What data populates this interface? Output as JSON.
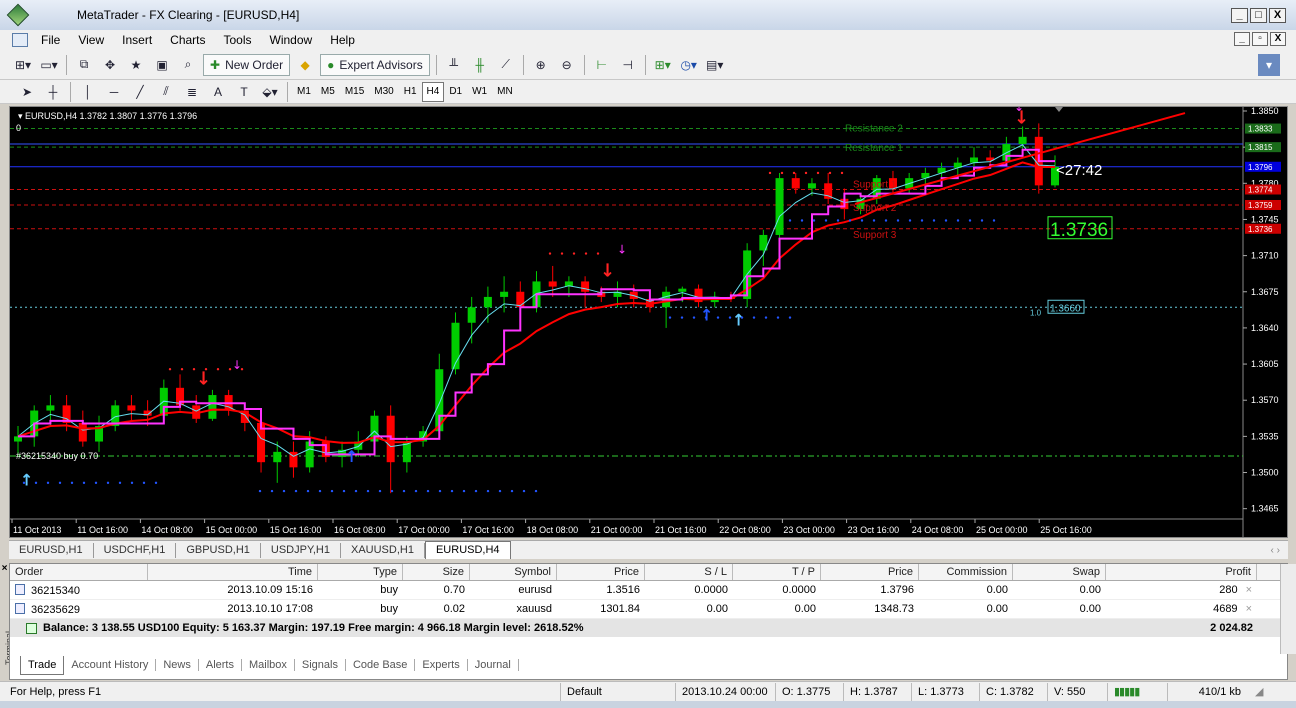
{
  "window": {
    "title": "MetaTrader - FX Clearing - [EURUSD,H4]",
    "buttons": [
      "_",
      "□",
      "X"
    ]
  },
  "menu": {
    "items": [
      "File",
      "View",
      "Insert",
      "Charts",
      "Tools",
      "Window",
      "Help"
    ],
    "mdi_buttons": [
      "_",
      "▫",
      "X"
    ]
  },
  "toolbar": {
    "new_order": "New Order",
    "expert_advisors": "Expert Advisors",
    "timeframes": [
      "M1",
      "M5",
      "M15",
      "M30",
      "H1",
      "H4",
      "D1",
      "W1",
      "MN"
    ],
    "active_timeframe": "H4",
    "text_tool": "A"
  },
  "chart": {
    "header": "EURUSD,H4  1.3782 1.3807 1.3776 1.3796",
    "corner_label": "0",
    "timer": "<27:42",
    "big_price": "1.3736",
    "small_label": "1.3660",
    "small_label_prefix": "1.0",
    "order_label": "#36215340 buy 0.70",
    "levels": {
      "resistance2": "Resistance 2",
      "resistance1": "Resistance 1",
      "support1": "Support 1",
      "support2": "Support 2",
      "support3": "Support 3"
    },
    "colors": {
      "bull": "#00cc00",
      "bear": "#ff0000",
      "ma_red": "#ff0000",
      "ma_green": "#33ff33",
      "magenta": "#ff33ff",
      "cyan": "#66ddee",
      "axis_text": "#ffffff"
    }
  },
  "chart_data": {
    "type": "candlestick",
    "title": "EURUSD,H4",
    "ylim": [
      1.3455,
      1.385
    ],
    "y_ticks": [
      "1.3850",
      "1.3815",
      "1.3780",
      "1.3745",
      "1.3710",
      "1.3675",
      "1.3640",
      "1.3605",
      "1.3570",
      "1.3535",
      "1.3500",
      "1.3465"
    ],
    "price_tags": [
      {
        "label": "1.3833",
        "color": "#1a6b1a"
      },
      {
        "label": "1.3815",
        "color": "#1a6b1a"
      },
      {
        "label": "1.3796",
        "color": "#0000dd"
      },
      {
        "label": "1.3774",
        "color": "#cc0000"
      },
      {
        "label": "1.3759",
        "color": "#cc0000"
      },
      {
        "label": "1.3736",
        "color": "#cc0000"
      }
    ],
    "x_labels": [
      "11 Oct 2013",
      "11 Oct 16:00",
      "14 Oct 08:00",
      "15 Oct 00:00",
      "15 Oct 16:00",
      "16 Oct 08:00",
      "17 Oct 00:00",
      "17 Oct 16:00",
      "18 Oct 08:00",
      "21 Oct 00:00",
      "21 Oct 16:00",
      "22 Oct 08:00",
      "23 Oct 00:00",
      "23 Oct 16:00",
      "24 Oct 08:00",
      "25 Oct 00:00",
      "25 Oct 16:00"
    ],
    "ohlc": [
      [
        1.353,
        1.3545,
        1.3515,
        1.3535
      ],
      [
        1.3535,
        1.3565,
        1.3525,
        1.356
      ],
      [
        1.356,
        1.3575,
        1.3545,
        1.3565
      ],
      [
        1.3565,
        1.3575,
        1.354,
        1.3548
      ],
      [
        1.3548,
        1.356,
        1.3525,
        1.353
      ],
      [
        1.353,
        1.3555,
        1.352,
        1.3545
      ],
      [
        1.3545,
        1.357,
        1.354,
        1.3565
      ],
      [
        1.3565,
        1.3575,
        1.355,
        1.356
      ],
      [
        1.356,
        1.357,
        1.3545,
        1.3555
      ],
      [
        1.3555,
        1.359,
        1.355,
        1.3582
      ],
      [
        1.3582,
        1.3595,
        1.356,
        1.3565
      ],
      [
        1.3565,
        1.3575,
        1.3548,
        1.3552
      ],
      [
        1.3552,
        1.358,
        1.355,
        1.3575
      ],
      [
        1.3575,
        1.358,
        1.3555,
        1.356
      ],
      [
        1.356,
        1.3565,
        1.354,
        1.3548
      ],
      [
        1.3548,
        1.356,
        1.35,
        1.351
      ],
      [
        1.351,
        1.353,
        1.349,
        1.352
      ],
      [
        1.352,
        1.353,
        1.3495,
        1.3505
      ],
      [
        1.3505,
        1.354,
        1.35,
        1.353
      ],
      [
        1.353,
        1.3535,
        1.351,
        1.3515
      ],
      [
        1.3515,
        1.353,
        1.3505,
        1.3522
      ],
      [
        1.3522,
        1.354,
        1.3515,
        1.353
      ],
      [
        1.353,
        1.356,
        1.3525,
        1.3555
      ],
      [
        1.3555,
        1.3565,
        1.348,
        1.351
      ],
      [
        1.351,
        1.3535,
        1.35,
        1.353
      ],
      [
        1.353,
        1.3545,
        1.3525,
        1.354
      ],
      [
        1.354,
        1.3615,
        1.3535,
        1.36
      ],
      [
        1.36,
        1.3655,
        1.3595,
        1.3645
      ],
      [
        1.3645,
        1.367,
        1.3625,
        1.366
      ],
      [
        1.366,
        1.368,
        1.3645,
        1.367
      ],
      [
        1.367,
        1.369,
        1.3655,
        1.3675
      ],
      [
        1.3675,
        1.3685,
        1.365,
        1.366
      ],
      [
        1.366,
        1.3695,
        1.3655,
        1.3685
      ],
      [
        1.3685,
        1.37,
        1.367,
        1.368
      ],
      [
        1.368,
        1.369,
        1.367,
        1.3685
      ],
      [
        1.3685,
        1.369,
        1.366,
        1.3675
      ],
      [
        1.3675,
        1.368,
        1.3665,
        1.367
      ],
      [
        1.367,
        1.3685,
        1.366,
        1.3675
      ],
      [
        1.3675,
        1.3682,
        1.366,
        1.3668
      ],
      [
        1.3668,
        1.3675,
        1.3655,
        1.366
      ],
      [
        1.366,
        1.368,
        1.364,
        1.3675
      ],
      [
        1.3675,
        1.368,
        1.3665,
        1.3678
      ],
      [
        1.3678,
        1.3682,
        1.366,
        1.3665
      ],
      [
        1.3665,
        1.3675,
        1.366,
        1.367
      ],
      [
        1.367,
        1.3675,
        1.3665,
        1.3668
      ],
      [
        1.3668,
        1.3722,
        1.366,
        1.3715
      ],
      [
        1.3715,
        1.3735,
        1.37,
        1.373
      ],
      [
        1.373,
        1.379,
        1.3725,
        1.3785
      ],
      [
        1.3785,
        1.379,
        1.377,
        1.3775
      ],
      [
        1.3775,
        1.3785,
        1.3768,
        1.378
      ],
      [
        1.378,
        1.379,
        1.376,
        1.3765
      ],
      [
        1.3765,
        1.3775,
        1.3745,
        1.3755
      ],
      [
        1.3755,
        1.377,
        1.375,
        1.3765
      ],
      [
        1.3765,
        1.3788,
        1.376,
        1.3785
      ],
      [
        1.3785,
        1.3792,
        1.377,
        1.3775
      ],
      [
        1.3775,
        1.379,
        1.377,
        1.3785
      ],
      [
        1.3785,
        1.3795,
        1.377,
        1.379
      ],
      [
        1.379,
        1.38,
        1.3782,
        1.3795
      ],
      [
        1.3795,
        1.3805,
        1.3785,
        1.38
      ],
      [
        1.38,
        1.3815,
        1.379,
        1.3805
      ],
      [
        1.3805,
        1.3812,
        1.3795,
        1.3802
      ],
      [
        1.3802,
        1.3825,
        1.3798,
        1.3818
      ],
      [
        1.3818,
        1.3835,
        1.3805,
        1.3825
      ],
      [
        1.3825,
        1.3838,
        1.377,
        1.3778
      ],
      [
        1.3778,
        1.3807,
        1.3776,
        1.3796
      ]
    ]
  },
  "tabs": [
    "EURUSD,H1",
    "USDCHF,H1",
    "GBPUSD,H1",
    "USDJPY,H1",
    "XAUUSD,H1",
    "EURUSD,H4"
  ],
  "active_tab": "EURUSD,H4",
  "terminal": {
    "sidebar_label": "Terminal",
    "columns": [
      "Order",
      "Time",
      "Type",
      "Size",
      "Symbol",
      "Price",
      "S / L",
      "T / P",
      "Price",
      "Commission",
      "Swap",
      "Profit"
    ],
    "rows": [
      {
        "order": "36215340",
        "time": "2013.10.09 15:16",
        "type": "buy",
        "size": "0.70",
        "symbol": "eurusd",
        "price": "1.3516",
        "sl": "0.0000",
        "tp": "0.0000",
        "cur_price": "1.3796",
        "commission": "0.00",
        "swap": "0.00",
        "profit": "280"
      },
      {
        "order": "36235629",
        "time": "2013.10.10 17:08",
        "type": "buy",
        "size": "0.02",
        "symbol": "xauusd",
        "price": "1301.84",
        "sl": "0.00",
        "tp": "0.00",
        "cur_price": "1348.73",
        "commission": "0.00",
        "swap": "0.00",
        "profit": "4689"
      }
    ],
    "balance": "Balance: 3 138.55 USD100  Equity: 5 163.37  Margin: 197.19  Free margin: 4 966.18  Margin level: 2618.52%",
    "total_profit": "2 024.82",
    "tabs": [
      "Trade",
      "Account History",
      "News",
      "Alerts",
      "Mailbox",
      "Signals",
      "Code Base",
      "Experts",
      "Journal"
    ],
    "active_tab": "Trade"
  },
  "status": {
    "help": "For Help, press F1",
    "profile": "Default",
    "datetime": "2013.10.24 00:00",
    "open": "O: 1.3775",
    "high": "H: 1.3787",
    "low": "L: 1.3773",
    "close": "C: 1.3782",
    "volume": "V: 550",
    "traffic": "410/1 kb"
  }
}
